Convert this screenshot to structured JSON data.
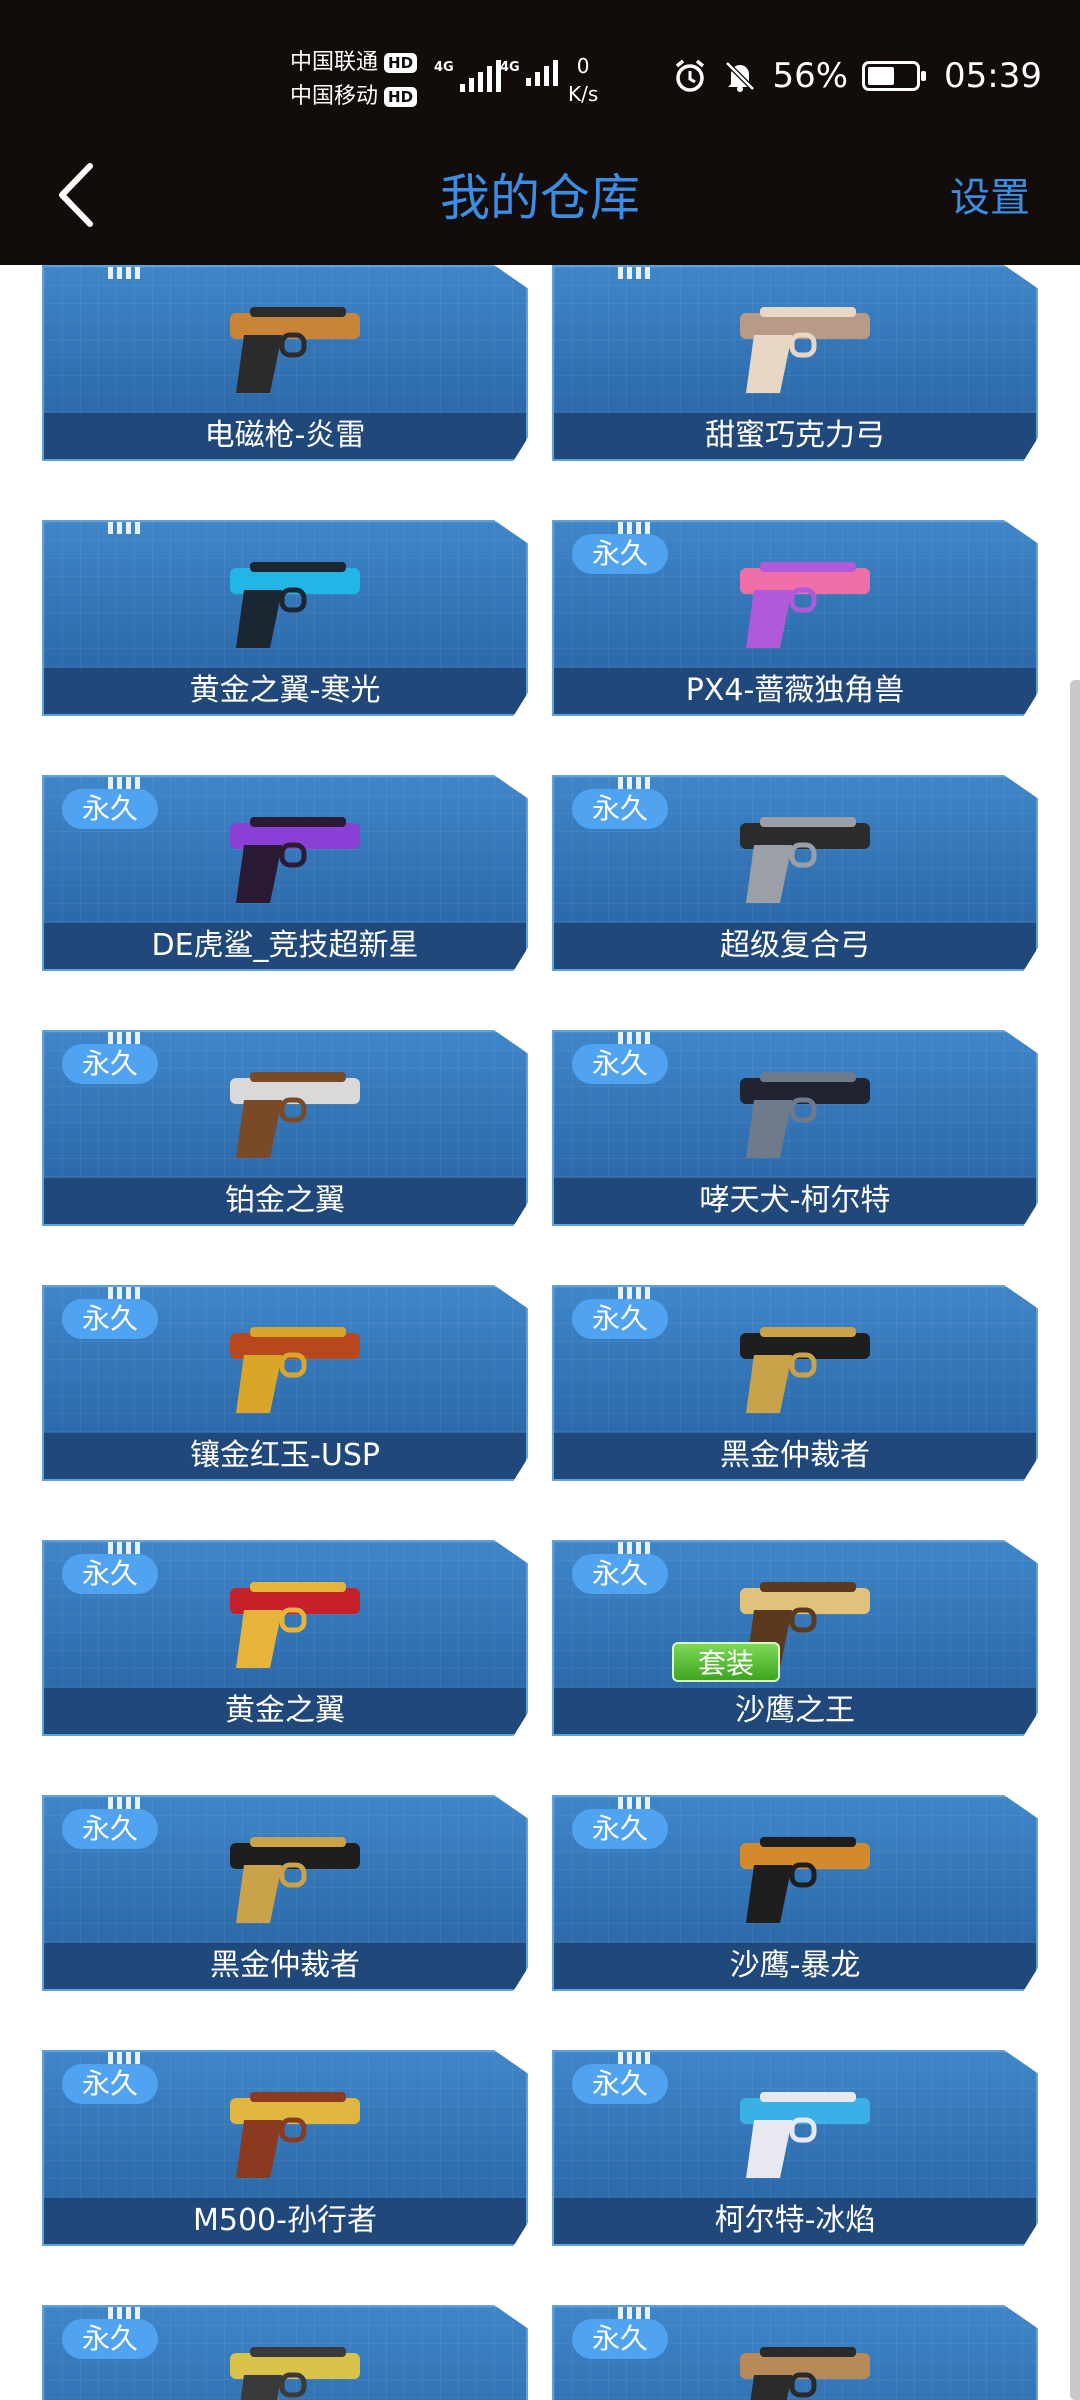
{
  "status_bar": {
    "carrier1": "中国联通",
    "carrier2": "中国移动",
    "hd": "HD",
    "net_gen": "4G",
    "speed_value": "0",
    "speed_unit": "K/s",
    "battery_percent": "56%",
    "battery_level": 0.56,
    "time": "05:39"
  },
  "nav": {
    "title": "我的仓库",
    "settings": "设置"
  },
  "labels": {
    "permanent": "永久",
    "set": "套装"
  },
  "items": [
    {
      "name": "电磁枪-炎雷",
      "permanent": false,
      "set": false,
      "colors": [
        "#c9843a",
        "#2b2b2b"
      ]
    },
    {
      "name": "甜蜜巧克力弓",
      "permanent": false,
      "set": false,
      "colors": [
        "#b89a86",
        "#e8d7c4"
      ]
    },
    {
      "name": "黄金之翼-寒光",
      "permanent": false,
      "set": false,
      "colors": [
        "#22b6e6",
        "#1b2633"
      ]
    },
    {
      "name": "PX4-蔷薇独角兽",
      "permanent": true,
      "set": false,
      "colors": [
        "#f06fa8",
        "#b05ad9"
      ]
    },
    {
      "name": "DE虎鲨_竞技超新星",
      "permanent": true,
      "set": false,
      "colors": [
        "#8a3fd6",
        "#2a1a33"
      ]
    },
    {
      "name": "超级复合弓",
      "permanent": true,
      "set": false,
      "colors": [
        "#2b2b2b",
        "#9aa0a6"
      ]
    },
    {
      "name": "铂金之翼",
      "permanent": true,
      "set": false,
      "colors": [
        "#d9d9d9",
        "#7a4a28"
      ]
    },
    {
      "name": "哮天犬-柯尔特",
      "permanent": true,
      "set": false,
      "colors": [
        "#1f2430",
        "#6f7a8a"
      ]
    },
    {
      "name": "镶金红玉-USP",
      "permanent": true,
      "set": false,
      "colors": [
        "#b8471e",
        "#d9a62a"
      ]
    },
    {
      "name": "黑金仲裁者",
      "permanent": true,
      "set": false,
      "colors": [
        "#1e1e1e",
        "#c9a24a"
      ]
    },
    {
      "name": "黄金之翼",
      "permanent": true,
      "set": false,
      "colors": [
        "#c6202a",
        "#e6b43a"
      ]
    },
    {
      "name": "沙鹰之王",
      "permanent": true,
      "set": true,
      "colors": [
        "#e2c27a",
        "#5a3a1e"
      ]
    },
    {
      "name": "黑金仲裁者",
      "permanent": true,
      "set": false,
      "colors": [
        "#1e1e1e",
        "#c9a24a"
      ]
    },
    {
      "name": "沙鹰-暴龙",
      "permanent": true,
      "set": false,
      "colors": [
        "#d38a2a",
        "#1e1e1e"
      ]
    },
    {
      "name": "M500-孙行者",
      "permanent": true,
      "set": false,
      "colors": [
        "#e0b640",
        "#8a3a1e"
      ]
    },
    {
      "name": "柯尔特-冰焰",
      "permanent": true,
      "set": false,
      "colors": [
        "#3ab0e6",
        "#e8e8f0"
      ]
    },
    {
      "name": "",
      "permanent": true,
      "set": false,
      "colors": [
        "#d9c24a",
        "#3a3a3a"
      ]
    },
    {
      "name": "",
      "permanent": true,
      "set": false,
      "colors": [
        "#b88a5a",
        "#2a2a2a"
      ]
    }
  ]
}
